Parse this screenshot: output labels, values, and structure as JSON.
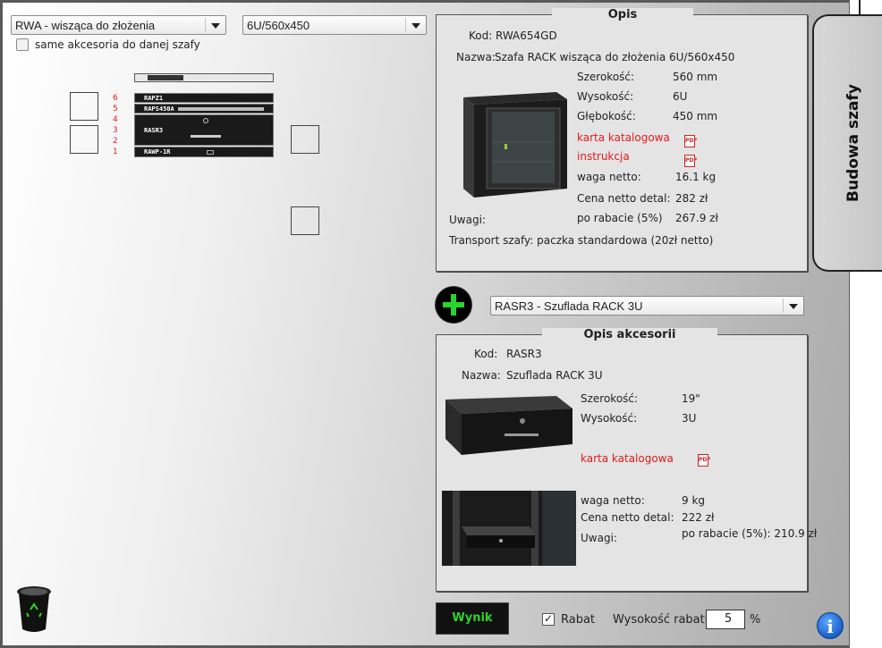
{
  "top": {
    "cabinet_type": "RWA - wisząca do złożenia",
    "cabinet_size": "6U/560x450",
    "same_accessories_label": "same akcesoria do danej szafy"
  },
  "rack": {
    "unit_numbers": [
      "6",
      "5",
      "4",
      "3",
      "2",
      "1"
    ],
    "units": [
      "RAPZ1",
      "RAPS450A",
      "RASR3",
      "RAWP-1R"
    ]
  },
  "opis": {
    "title": "Opis",
    "kod_label": "Kod:",
    "kod_value": "RWA654GD",
    "nazwa_label": "Nazwa:",
    "nazwa_value": "Szafa RACK wisząca do złożenia 6U/560x450",
    "szerokosc_label": "Szerokość:",
    "szerokosc_value": "560 mm",
    "wysokosc_label": "Wysokość:",
    "wysokosc_value": "6U",
    "glebokosc_label": "Głębokość:",
    "glebokosc_value": "450 mm",
    "karta_link": "karta katalogowa",
    "instrukcja_link": "instrukcja",
    "waga_label": "waga netto:",
    "waga_value": "16.1 kg",
    "cena_label": "Cena netto detal:",
    "cena_value": "282 zł",
    "rabat_label": "po rabacie (5%)",
    "rabat_value": "267.9 zł",
    "uwagi_label": "Uwagi:",
    "transport": "Transport szafy: paczka standardowa (20zł netto)"
  },
  "accessory_select": "RASR3 - Szuflada RACK 3U",
  "akcesoria": {
    "title": "Opis akcesorii",
    "kod_label": "Kod:",
    "kod_value": "RASR3",
    "nazwa_label": "Nazwa:",
    "nazwa_value": "Szuflada RACK 3U",
    "szerokosc_label": "Szerokość:",
    "szerokosc_value": "19\"",
    "wysokosc_label": "Wysokość:",
    "wysokosc_value": "3U",
    "karta_link": "karta katalogowa",
    "waga_label": "waga netto:",
    "waga_value": "9 kg",
    "cena_label": "Cena netto detal:",
    "cena_value": "222 zł",
    "uwagi_label": "Uwagi:",
    "rabat_text": "po rabacie (5%): 210.9 zł"
  },
  "bottom": {
    "wynik_label": "Wynik",
    "rabat_label": "Rabat",
    "rabat_checked": "✓",
    "wysokosc_rabatu_label": "Wysokość rabatu:",
    "rabat_value": "5",
    "percent": "%",
    "info_glyph": "i"
  },
  "side_tab": {
    "label": "Budowa szafy"
  },
  "colors": {
    "accent_green": "#2bd42b",
    "link_red": "#e21b1b",
    "panel_bg": "#e4e4e4"
  }
}
